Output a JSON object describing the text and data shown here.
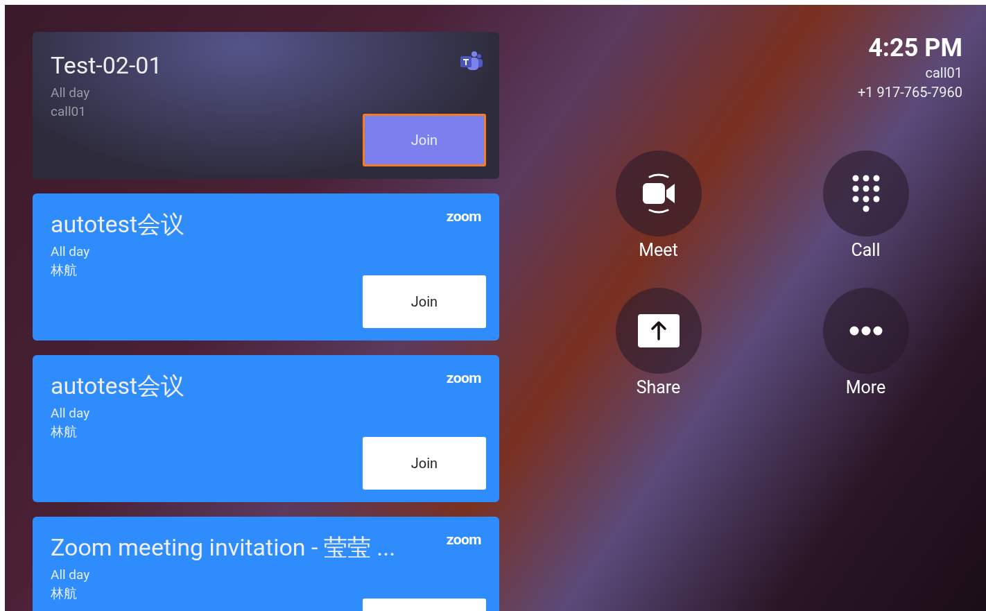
{
  "meetings": [
    {
      "kind": "teams",
      "title": "Test-02-01",
      "time": "All day",
      "organizer": "call01",
      "join": {
        "label": "Join",
        "focused": true
      }
    },
    {
      "kind": "zoom",
      "logo": "zoom",
      "title": "autotest会议",
      "time": "All day",
      "organizer": "林航",
      "join": {
        "label": "Join",
        "focused": false
      }
    },
    {
      "kind": "zoom",
      "logo": "zoom",
      "title": "autotest会议",
      "time": "All day",
      "organizer": "林航",
      "join": {
        "label": "Join",
        "focused": false
      }
    },
    {
      "kind": "zoom",
      "logo": "zoom",
      "title": "Zoom meeting invitation - 莹莹 ...",
      "time": "All day",
      "organizer": "林航",
      "join": {
        "focused": false
      }
    }
  ],
  "status": {
    "time": "4:25 PM",
    "name": "call01",
    "number": "+1 917-765-7960"
  },
  "actions": [
    {
      "kind": "meet",
      "label": "Meet"
    },
    {
      "kind": "call",
      "label": "Call"
    },
    {
      "kind": "share",
      "label": "Share"
    },
    {
      "kind": "more",
      "label": "More"
    }
  ]
}
